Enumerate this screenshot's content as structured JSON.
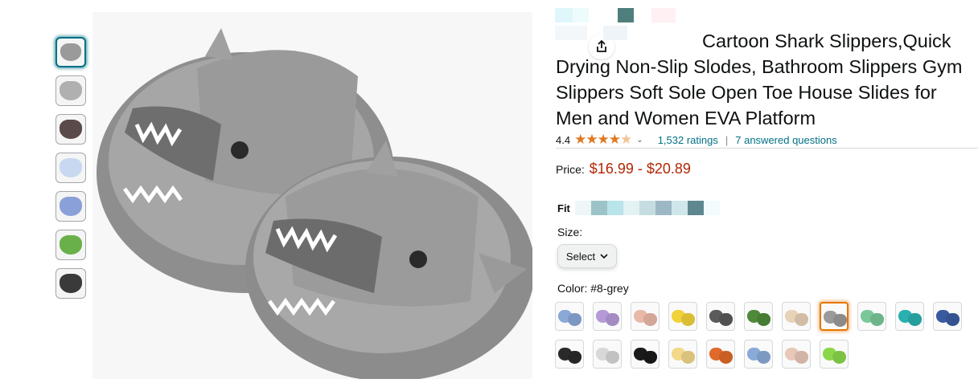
{
  "product": {
    "title": "Cartoon Shark Slippers,Quick Drying Non-Slip Slodes, Bathroom Slippers Gym Slippers Soft Sole Open Toe House Slides for Men and Women EVA Platform",
    "rating_value": "4.4",
    "rating_stars": 4.4,
    "ratings_count": "1,532 ratings",
    "answered_questions": "7 answered questions",
    "price_label": "Price:",
    "price": "$16.99 - $20.89"
  },
  "fit": {
    "label": "Fit"
  },
  "size": {
    "label": "Size:",
    "select_value": "Select"
  },
  "color": {
    "label": "Color:",
    "selected_value": "#8-grey",
    "swatches_row1": [
      "#8aa8d8",
      "#b69ad8",
      "#eab8a8",
      "#f2d23a",
      "#5a5a5a",
      "#4e8a3a",
      "#e8d2b8",
      "#9a9a9a",
      "#7ac89a",
      "#2ab0b0",
      "#3a5aa0"
    ],
    "swatches_row2": [
      "#2a2a2a",
      "#d8d8d8",
      "#1a1a1a",
      "#f2d88a",
      "#e06a2a",
      "#8aaad8",
      "#e8c8b8",
      "#8ad84a"
    ]
  },
  "thumbnails": [
    "#9a9a9a",
    "#b0b0b0",
    "#5a4a4a",
    "#c8d8f0",
    "#8aa0d8",
    "#6ab04a",
    "#3a3a3a"
  ],
  "image": {
    "main_color": "#9e9e9e"
  }
}
